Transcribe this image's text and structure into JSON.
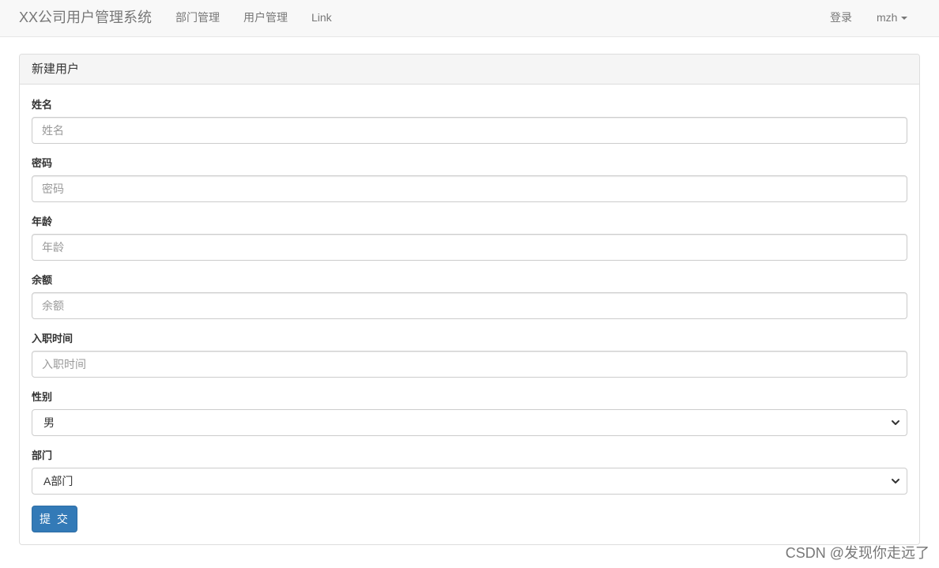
{
  "navbar": {
    "brand": "XX公司用户管理系统",
    "links": [
      "部门管理",
      "用户管理",
      "Link"
    ],
    "login": "登录",
    "user": "mzh"
  },
  "panel": {
    "title": "新建用户",
    "fields": [
      {
        "label": "姓名",
        "placeholder": "姓名"
      },
      {
        "label": "密码",
        "placeholder": "密码"
      },
      {
        "label": "年龄",
        "placeholder": "年龄"
      },
      {
        "label": "余额",
        "placeholder": "余额"
      },
      {
        "label": "入职时间",
        "placeholder": "入职时间"
      }
    ],
    "gender": {
      "label": "性别",
      "value": "男"
    },
    "department": {
      "label": "部门",
      "value": "A部门"
    },
    "submit": "提 交"
  },
  "watermark": "CSDN @发现你走远了"
}
